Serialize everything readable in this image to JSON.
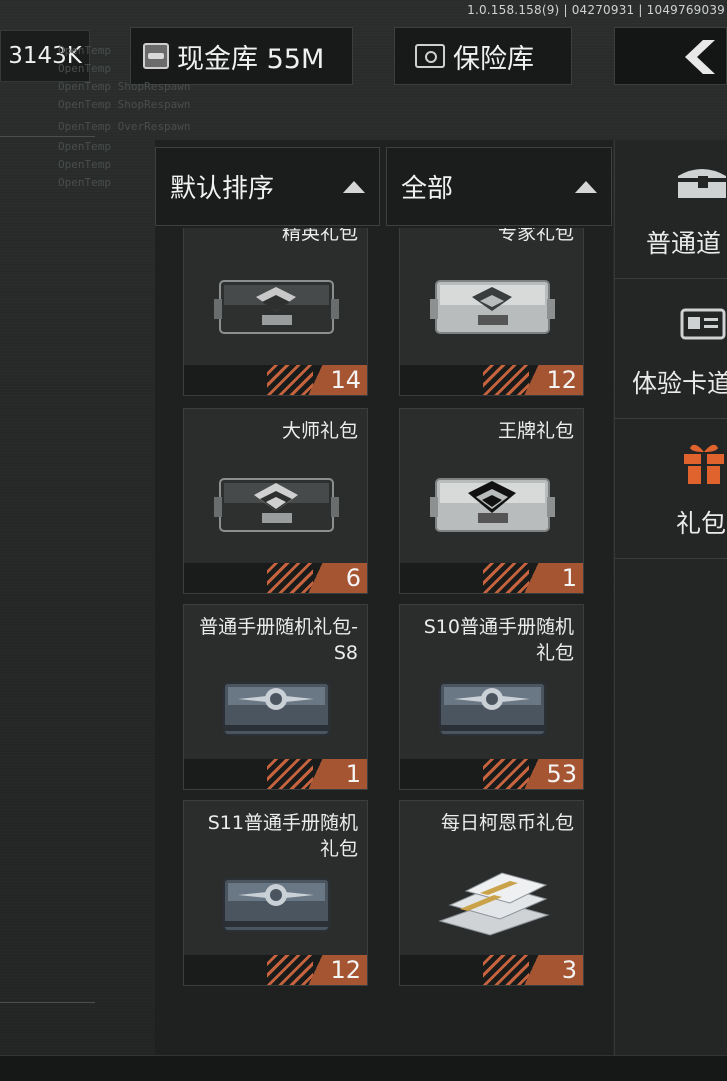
{
  "version": "1.0.158.158(9) | 04270931 | 1049769039",
  "header": {
    "balance": "3143K",
    "cash_vault": {
      "label": "现金库 55M",
      "icon": "cash-icon"
    },
    "safe": {
      "label": "保险库",
      "icon": "safe-icon"
    },
    "back": {
      "icon": "back-arrow-icon"
    }
  },
  "filters": {
    "sort": {
      "label": "默认排序",
      "icon": "caret-up-icon"
    },
    "category": {
      "label": "全部",
      "icon": "caret-up-icon"
    }
  },
  "items": [
    {
      "name": "精英礼包",
      "count": "14",
      "image": "crate-dark-icon"
    },
    {
      "name": "专家礼包",
      "count": "12",
      "image": "crate-silver-icon"
    },
    {
      "name": "大师礼包",
      "count": "6",
      "image": "crate-dark-icon"
    },
    {
      "name": "王牌礼包",
      "count": "1",
      "image": "crate-silver-icon"
    },
    {
      "name": "普通手册随机礼包-S8",
      "count": "1",
      "image": "crate-blue-icon"
    },
    {
      "name": "S10普通手册随机礼包",
      "count": "53",
      "image": "crate-blue-icon"
    },
    {
      "name": "S11普通手册随机礼包",
      "count": "12",
      "image": "crate-blue-icon"
    },
    {
      "name": "每日柯恩币礼包",
      "count": "3",
      "image": "cash-stack-icon"
    }
  ],
  "categories": [
    {
      "label": "普通道",
      "icon": "chest-icon"
    },
    {
      "label": "体验卡道",
      "icon": "card-icon"
    },
    {
      "label": "礼包",
      "icon": "gift-icon"
    }
  ],
  "colors": {
    "accent": "#a65533",
    "stripe": "#c4633d",
    "gift": "#e0632e"
  }
}
